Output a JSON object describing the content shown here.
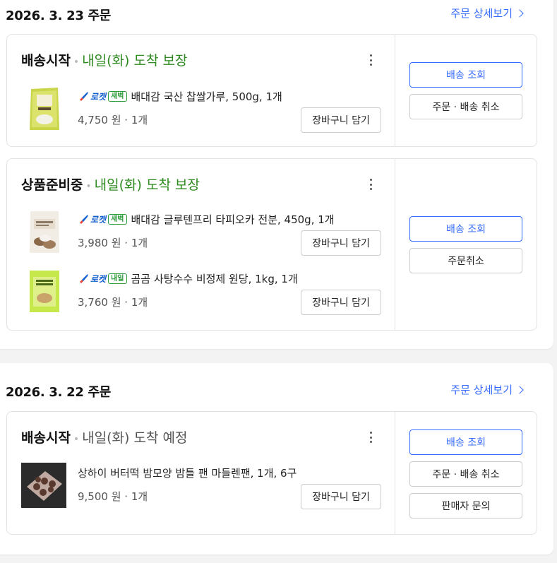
{
  "orders": [
    {
      "date": "2026. 3. 23 주문",
      "detail_link": "주문 상세보기",
      "shipments": [
        {
          "status": "배송시작",
          "arrival": "내일(화) 도착 보장",
          "items": [
            {
              "rocket": "로켓",
              "badge": "새벽",
              "name": "배대감 국산 찹쌀가루, 500g, 1개",
              "price": "4,750 원 · 1개",
              "cart": "장바구니 담기",
              "thumb": "rice-flour-bag"
            }
          ],
          "actions": [
            "배송 조회",
            "주문 · 배송 취소"
          ]
        },
        {
          "status": "상품준비중",
          "arrival": "내일(화) 도착 보장",
          "items": [
            {
              "rocket": "로켓",
              "badge": "새벽",
              "name": "배대감 글루텐프리 타피오카 전분, 450g, 1개",
              "price": "3,980 원 · 1개",
              "cart": "장바구니 담기",
              "thumb": "tapioca-bag"
            },
            {
              "rocket": "로켓",
              "badge": "내일",
              "name": "곰곰 사탕수수 비정제 원당, 1kg, 1개",
              "price": "3,760 원 · 1개",
              "cart": "장바구니 담기",
              "thumb": "sugar-bag"
            }
          ],
          "actions": [
            "배송 조회",
            "주문취소"
          ]
        }
      ]
    },
    {
      "date": "2026. 3. 22 주문",
      "detail_link": "주문 상세보기",
      "shipments": [
        {
          "status": "배송시작",
          "arrival": "내일(화) 도착 예정",
          "items": [
            {
              "name": "상하이 버터떡 밤모양 밤틀 팬 마들렌팬, 1개, 6구",
              "price": "9,500 원 · 1개",
              "cart": "장바구니 담기",
              "thumb": "chestnut-mold-pan"
            }
          ],
          "actions": [
            "배송 조회",
            "주문 · 배송 취소",
            "판매자 문의"
          ]
        }
      ]
    }
  ],
  "colors": {
    "accent": "#346aff",
    "arrival_green": "#2e8b1f",
    "rocket_blue": "#1460d0",
    "badge_green": "#2e9b3a"
  }
}
